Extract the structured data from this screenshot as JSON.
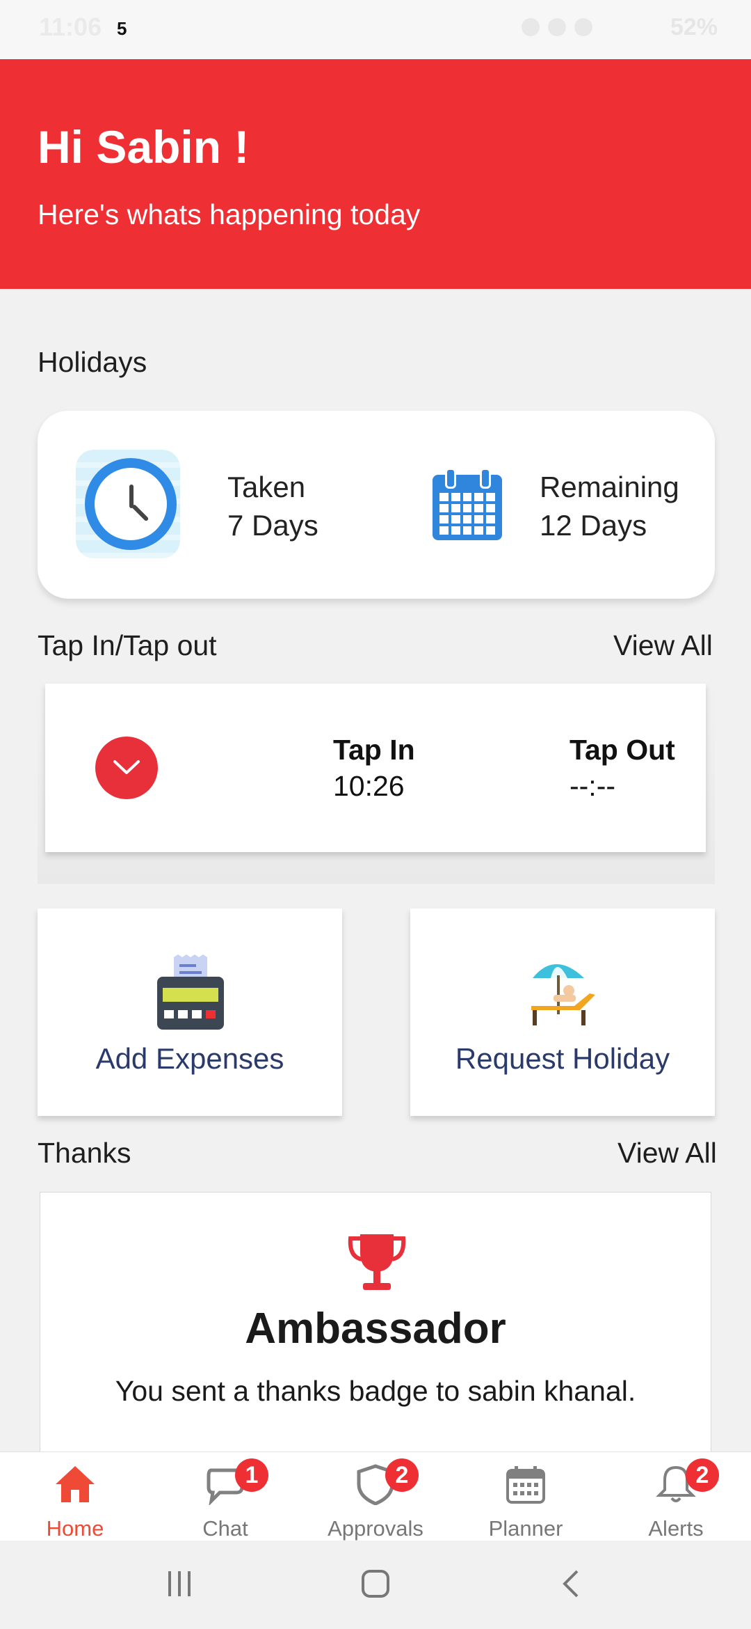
{
  "status_bar": {
    "time": "11:06",
    "notification_count": "5",
    "battery": "52%"
  },
  "header": {
    "greeting": "Hi Sabin !",
    "subtitle": "Here's whats happening today"
  },
  "holidays": {
    "section_title": "Holidays",
    "taken_label": "Taken",
    "taken_value": "7 Days",
    "remaining_label": "Remaining",
    "remaining_value": "12 Days"
  },
  "tap": {
    "section_title": "Tap In/Tap out",
    "view_all": "View All",
    "tap_in_label": "Tap In",
    "tap_in_value": "10:26",
    "tap_out_label": "Tap Out",
    "tap_out_value": "--:--"
  },
  "actions": {
    "add_expenses": "Add Expenses",
    "request_holiday": "Request Holiday"
  },
  "thanks": {
    "section_title": "Thanks",
    "view_all": "View All",
    "badge_title": "Ambassador",
    "message": "You sent a thanks badge to sabin khanal."
  },
  "bottom_nav": {
    "home": "Home",
    "chat": "Chat",
    "chat_badge": "1",
    "approvals": "Approvals",
    "approvals_badge": "2",
    "planner": "Planner",
    "alerts": "Alerts",
    "alerts_badge": "2"
  },
  "colors": {
    "brand_red": "#ee2f34",
    "text_navy": "#2a3a6a",
    "calendar_blue": "#2f86dc"
  }
}
